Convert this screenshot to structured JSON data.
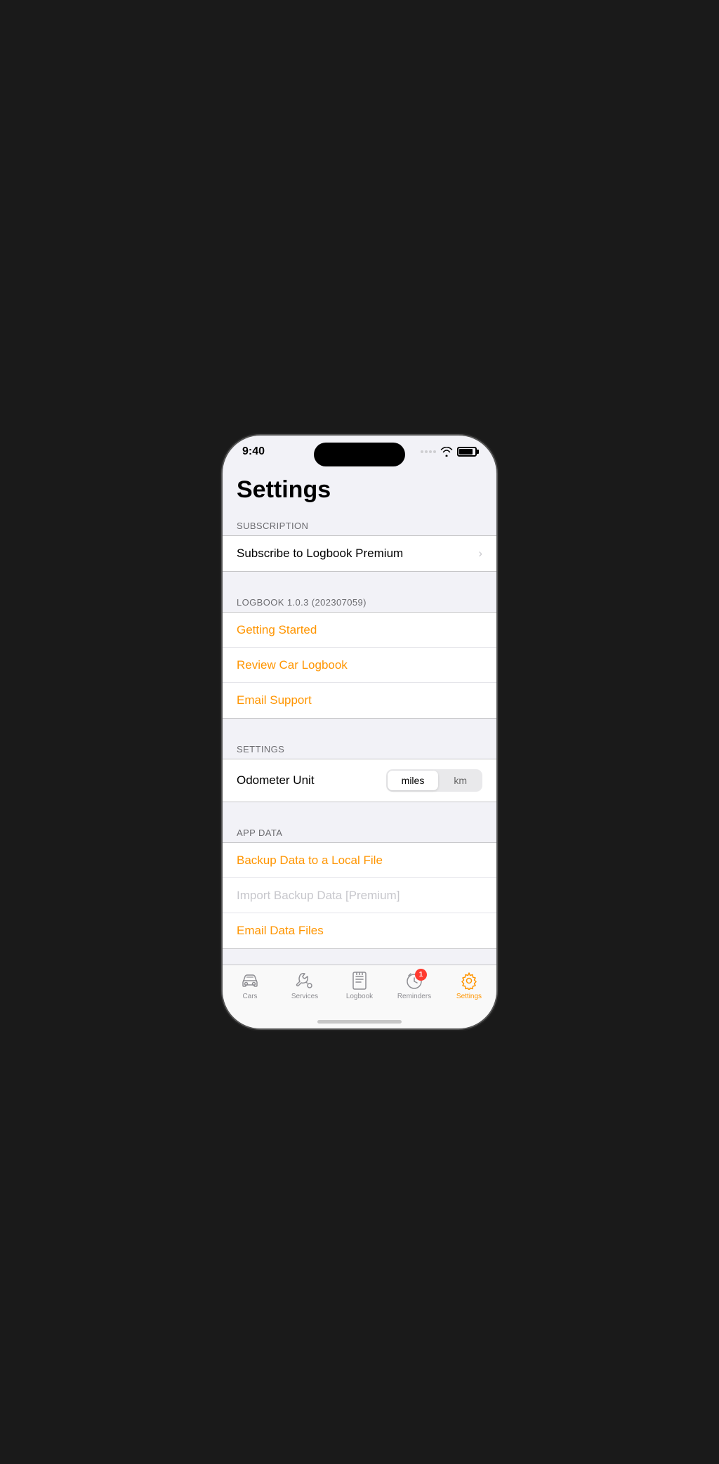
{
  "statusBar": {
    "time": "9:40"
  },
  "page": {
    "title": "Settings"
  },
  "sections": {
    "subscription": {
      "header": "SUBSCRIPTION",
      "items": [
        {
          "label": "Subscribe to Logbook Premium",
          "style": "normal",
          "chevron": true
        }
      ]
    },
    "logbook": {
      "header": "LOGBOOK 1.0.3 (202307059)",
      "items": [
        {
          "label": "Getting Started",
          "style": "orange",
          "chevron": false
        },
        {
          "label": "Review Car Logbook",
          "style": "orange",
          "chevron": false
        },
        {
          "label": "Email Support",
          "style": "orange",
          "chevron": false
        }
      ]
    },
    "settings": {
      "header": "SETTINGS",
      "odometer": {
        "label": "Odometer Unit",
        "options": [
          "miles",
          "km"
        ],
        "selected": "miles"
      }
    },
    "appData": {
      "header": "APP DATA",
      "items": [
        {
          "label": "Backup Data to a Local File",
          "style": "orange",
          "chevron": false
        },
        {
          "label": "Import Backup Data [Premium]",
          "style": "disabled",
          "chevron": false
        },
        {
          "label": "Email Data Files",
          "style": "orange",
          "chevron": false
        }
      ]
    }
  },
  "tabBar": {
    "items": [
      {
        "label": "Cars",
        "icon": "car",
        "active": false
      },
      {
        "label": "Services",
        "icon": "wrench",
        "active": false
      },
      {
        "label": "Logbook",
        "icon": "logbook",
        "active": false
      },
      {
        "label": "Reminders",
        "icon": "clock",
        "active": false,
        "badge": "1"
      },
      {
        "label": "Settings",
        "icon": "gear",
        "active": true
      }
    ]
  }
}
